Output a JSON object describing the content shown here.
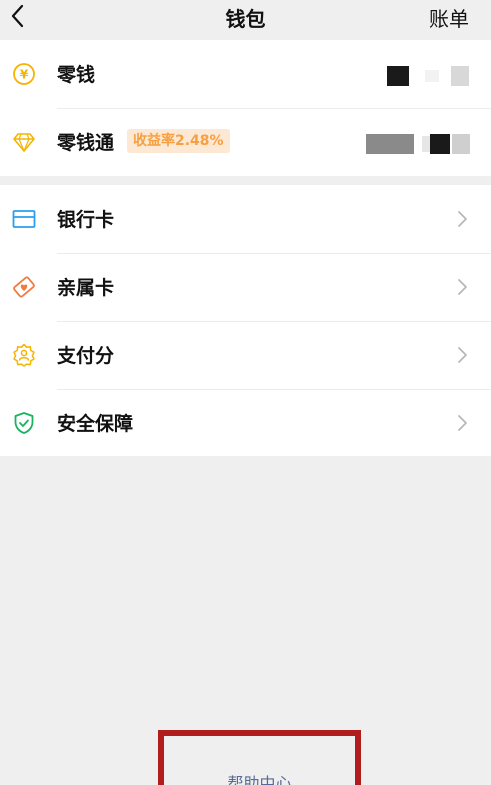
{
  "header": {
    "back_icon": "chevron-left-icon",
    "title": "钱包",
    "bill_label": "账单"
  },
  "top_section": {
    "items": [
      {
        "label": "零钱",
        "icon": "yuan-coin-icon",
        "icon_color": "#f5b400"
      },
      {
        "label": "零钱通",
        "icon": "diamond-icon",
        "icon_color": "#f5b400",
        "badge": "收益率2.48%"
      }
    ]
  },
  "services": {
    "items": [
      {
        "label": "银行卡",
        "icon": "bank-card-icon",
        "icon_color": "#2a9ff0"
      },
      {
        "label": "亲属卡",
        "icon": "family-card-icon",
        "icon_color": "#f27a3f"
      },
      {
        "label": "支付分",
        "icon": "pay-score-icon",
        "icon_color": "#f5b400"
      },
      {
        "label": "安全保障",
        "icon": "shield-check-icon",
        "icon_color": "#19b35f"
      }
    ]
  },
  "footer": {
    "help_label": "帮助中心"
  },
  "colors": {
    "background": "#efefef",
    "card": "#ffffff",
    "link": "#576b95",
    "highlight_box": "#b11d1d",
    "badge_bg": "#fde8d4",
    "badge_text": "#f7a041"
  }
}
